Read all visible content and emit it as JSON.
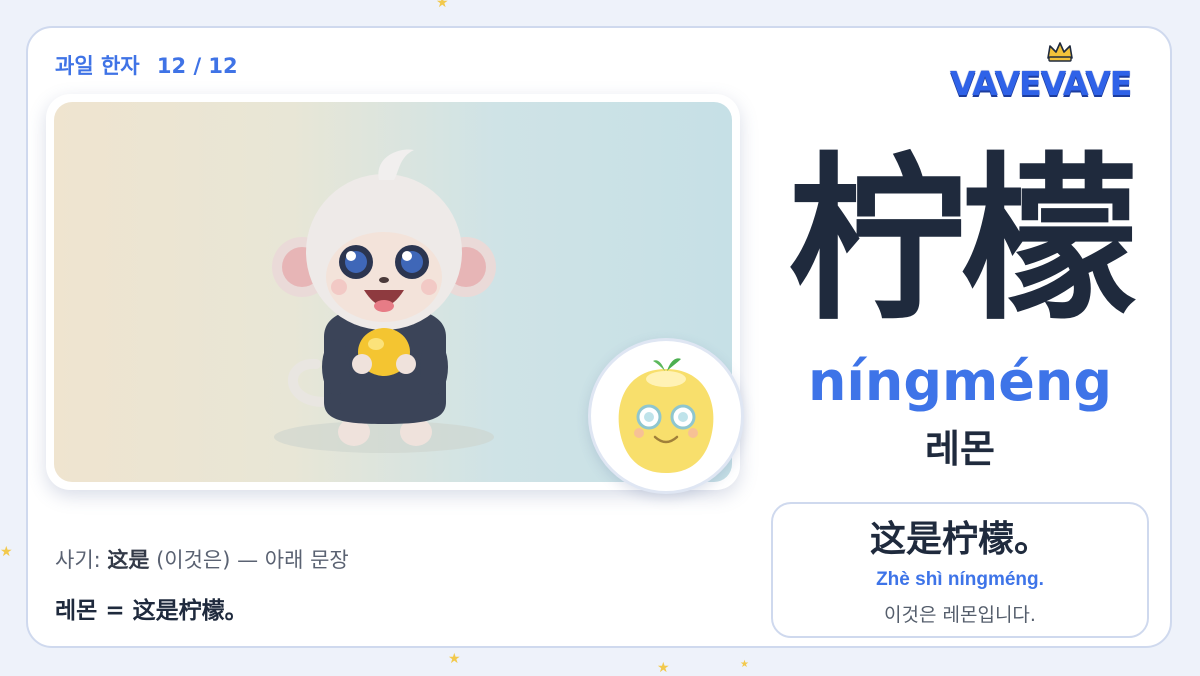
{
  "header": {
    "title": "과일 한자",
    "count": "12 / 12"
  },
  "logo": {
    "text": "VAVEVAVE",
    "icon": "crown-icon"
  },
  "word": {
    "hanzi": "柠檬",
    "pinyin": "níngméng",
    "meaning": "레몬"
  },
  "example": {
    "hanzi": "这是柠檬。",
    "pinyin": "Zhè shì níngméng.",
    "meaning": "이것은 레몬입니다."
  },
  "hint": {
    "prefix": "사기:",
    "term": "这是",
    "suffix": "(이것은) — 아래 문장"
  },
  "equation": "레몬 = 这是柠檬。",
  "illustration": {
    "main": "monkey-holding-lemon-illustration",
    "badge": "lemon-character-icon"
  },
  "colors": {
    "accent": "#3e74e8",
    "text": "#1f2a3d",
    "border": "#cfd9ee",
    "star": "#f2c94c"
  }
}
